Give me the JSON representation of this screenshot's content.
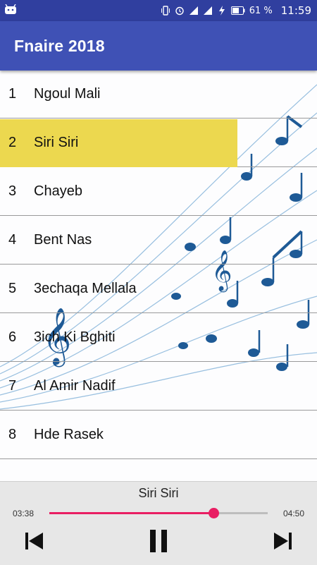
{
  "status": {
    "battery": "61 %",
    "time": "11:59"
  },
  "appbar": {
    "title": "Fnaire 2018"
  },
  "songs": [
    {
      "num": "1",
      "name": "Ngoul Mali"
    },
    {
      "num": "2",
      "name": " Siri Siri"
    },
    {
      "num": "3",
      "name": " Chayeb"
    },
    {
      "num": "4",
      "name": "Bent Nas"
    },
    {
      "num": "5",
      "name": "3echaqa Mellala"
    },
    {
      "num": "6",
      "name": "3ich Ki Bghiti"
    },
    {
      "num": "7",
      "name": "Al Amir Nadif"
    },
    {
      "num": "8",
      "name": "Hde Rasek"
    }
  ],
  "selected_index": 1,
  "player": {
    "now_playing": "Siri Siri",
    "elapsed": "03:38",
    "total": "04:50",
    "progress": 0.75
  },
  "colors": {
    "accent": "#e91e63",
    "appbar": "#3f51b5",
    "highlight": "#ecd84f"
  },
  "icons": {
    "prev": "skip-previous-icon",
    "pause": "pause-icon",
    "next": "skip-next-icon"
  }
}
